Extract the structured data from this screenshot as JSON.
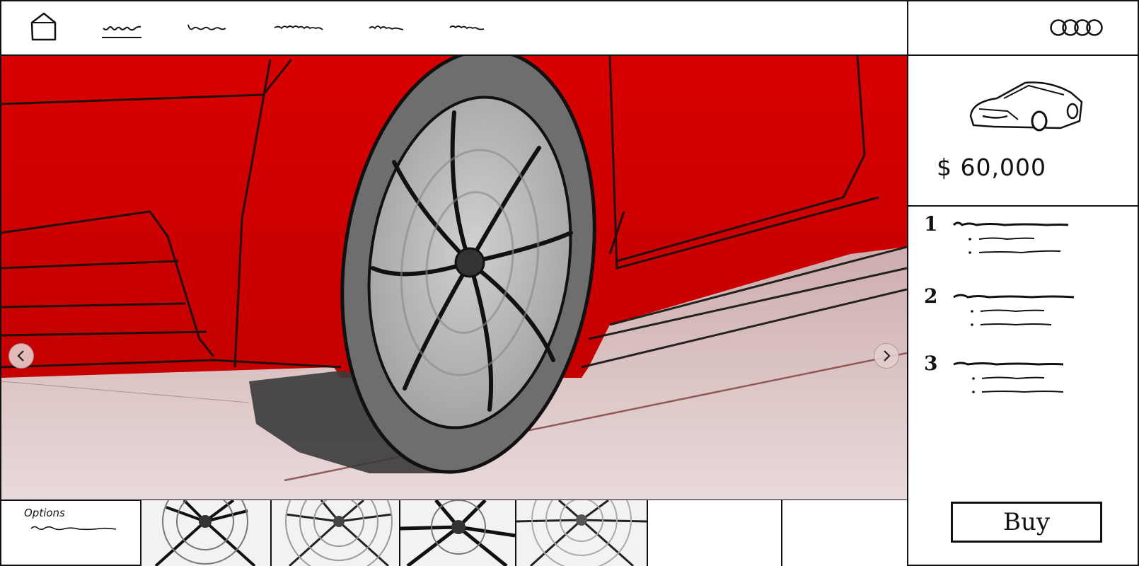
{
  "nav": {
    "home_icon": "home-icon",
    "items": [
      {
        "name": "nav-item-1",
        "active": true
      },
      {
        "name": "nav-item-2",
        "active": false
      },
      {
        "name": "nav-item-3",
        "active": false
      },
      {
        "name": "nav-item-4",
        "active": false
      },
      {
        "name": "nav-item-5",
        "active": false
      }
    ],
    "logo_icon": "four-rings-logo"
  },
  "hero": {
    "image": "red car wheel close-up",
    "prev_icon": "chevron-left-icon",
    "next_icon": "chevron-right-icon"
  },
  "thumbnails": {
    "options_label": "Options",
    "items": [
      "wheel-option-1",
      "wheel-option-2",
      "wheel-option-3",
      "wheel-option-4",
      "empty-slot",
      "empty-slot"
    ]
  },
  "product": {
    "image": "car-sketch",
    "price": "$ 60,000"
  },
  "specs": [
    {
      "number": "1"
    },
    {
      "number": "2"
    },
    {
      "number": "3"
    }
  ],
  "buy_label": "Buy",
  "colors": {
    "car_red": "#d40000",
    "tire_gray": "#6e6e6e",
    "rim_gray": "#b4b4b4",
    "floor_pink": "#caa0a0",
    "ink": "#111111"
  }
}
